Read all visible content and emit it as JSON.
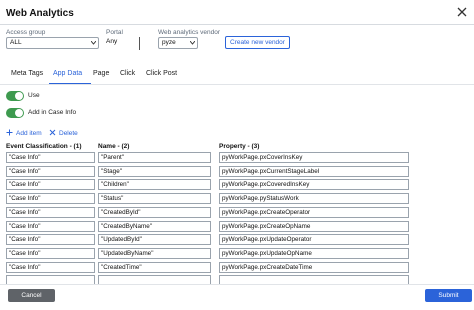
{
  "dialog": {
    "title": "Web Analytics"
  },
  "fields": {
    "access_group": {
      "label": "Access group",
      "value": "ALL"
    },
    "portal": {
      "label": "Portal",
      "value": "Any"
    },
    "vendor": {
      "label": "Web analytics vendor",
      "value": "pyze"
    },
    "create_vendor_label": "Create new vendor"
  },
  "tabs": [
    {
      "label": "Meta Tags",
      "active": false
    },
    {
      "label": "App Data",
      "active": true
    },
    {
      "label": "Page",
      "active": false
    },
    {
      "label": "Click",
      "active": false
    },
    {
      "label": "Click Post",
      "active": false
    }
  ],
  "toggles": {
    "use": {
      "label": "Use",
      "on": true
    },
    "add_in_case_info": {
      "label": "Add in Case Info",
      "on": true
    }
  },
  "actions": {
    "add_item": "Add item",
    "delete": "Delete"
  },
  "table": {
    "headers": [
      "Event Classification - (1)",
      "Name - (2)",
      "Property - (3)"
    ],
    "rows": [
      [
        "\"Case Info\"",
        "\"Parent\"",
        "pyWorkPage.pxCoverInsKey"
      ],
      [
        "\"Case Info\"",
        "\"Stage\"",
        "pyWorkPage.pxCurrentStageLabel"
      ],
      [
        "\"Case Info\"",
        "\"Children\"",
        "pyWorkPage.pxCoveredInsKey"
      ],
      [
        "\"Case Info\"",
        "\"Status\"",
        "pyWorkPage.pyStatusWork"
      ],
      [
        "\"Case Info\"",
        "\"CreatedById\"",
        "pyWorkPage.pxCreateOperator"
      ],
      [
        "\"Case Info\"",
        "\"CreatedByName\"",
        "pyWorkPage.pxCreateOpName"
      ],
      [
        "\"Case Info\"",
        "\"UpdatedById\"",
        "pyWorkPage.pxUpdateOperator"
      ],
      [
        "\"Case Info\"",
        "\"UpdatedByName\"",
        "pyWorkPage.pxUpdateOpName"
      ],
      [
        "\"Case Info\"",
        "\"CreatedTime\"",
        "pyWorkPage.pxCreateDateTime"
      ],
      [
        "",
        "",
        ""
      ]
    ]
  },
  "footer": {
    "cancel": "Cancel",
    "submit": "Submit"
  },
  "colors": {
    "accent": "#2b63d9",
    "toggle_on": "#3e9a4f",
    "cancel_bg": "#5f6368"
  }
}
